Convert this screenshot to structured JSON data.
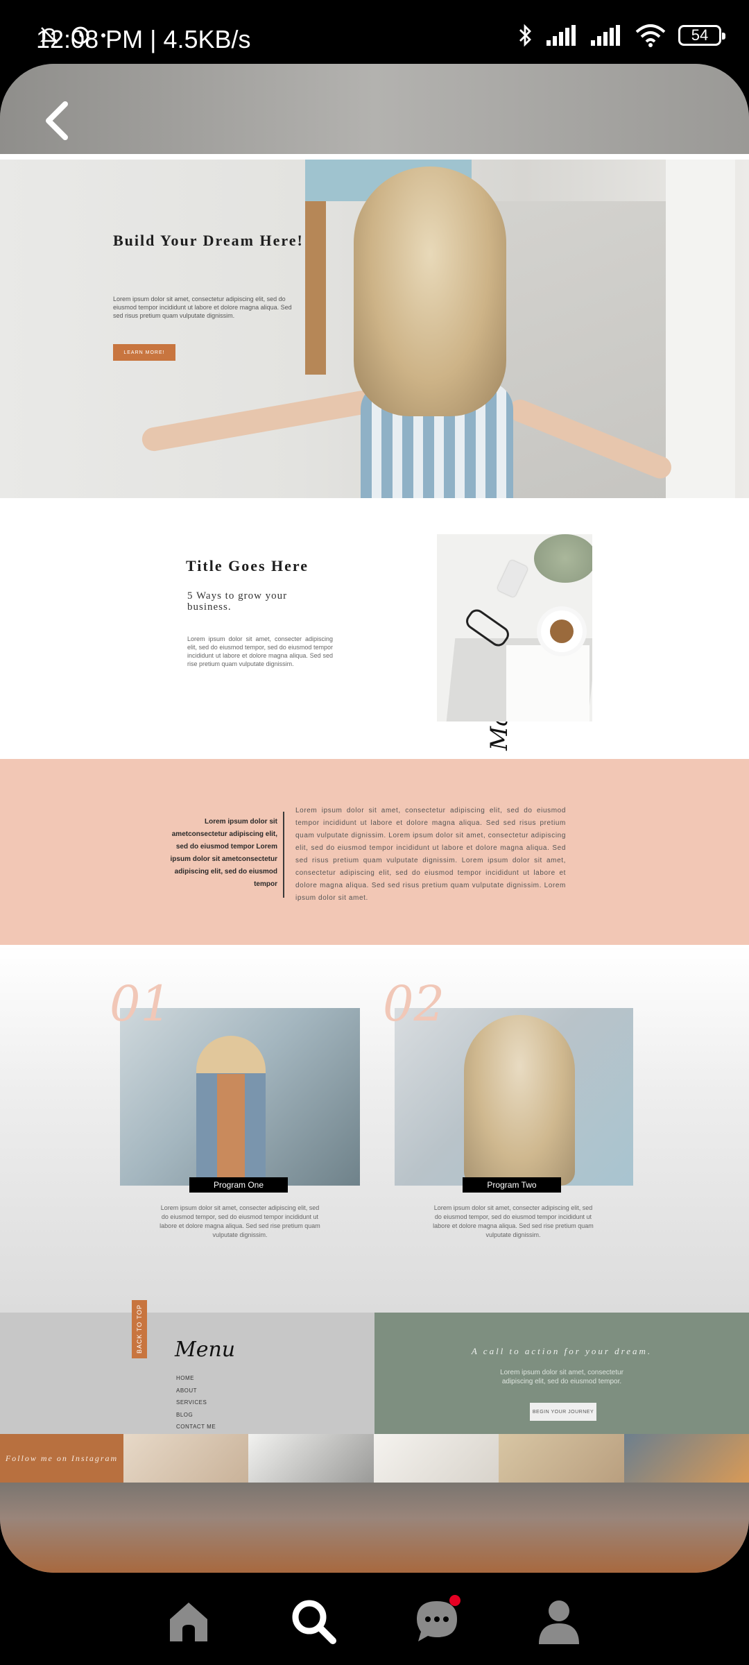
{
  "status_bar": {
    "time": "12:08 PM | 4.5KB/s",
    "battery": "54",
    "icons": [
      "mute-icon",
      "alarm-icon",
      "bluetooth-icon",
      "signal-icon",
      "signal-icon",
      "wifi-icon",
      "battery-icon"
    ]
  },
  "hero": {
    "title": "Build Your Dream Here!",
    "text": "Lorem ipsum dolor sit amet, consectetur adipiscing elit, sed do eiusmod tempor incididunt ut labore et dolore magna aliqua. Sed sed risus pretium quam vulputate dignissim.",
    "button": "LEARN MORE!"
  },
  "section2": {
    "title": "Title Goes Here",
    "subtitle": "5 Ways to grow your business.",
    "text": "Lorem ipsum dolor sit amet, consecter adipiscing elit, sed do eiusmod tempor, sed do eiusmod tempor incididunt ut labore et dolore magna aliqua. Sed sed rise pretium quam vulputate dignissim.",
    "script_label": "Free Masterclass"
  },
  "pink_band": {
    "left": "Lorem ipsum dolor sit ametconsectetur adipiscing elit, sed do eiusmod tempor Lorem ipsum dolor sit ametconsectetur adipiscing elit, sed do eiusmod tempor",
    "right": "Lorem ipsum dolor sit amet, consectetur adipiscing elit, sed do eiusmod tempor incididunt ut labore et dolore magna aliqua. Sed sed risus pretium quam vulputate dignissim. Lorem ipsum dolor sit amet, consectetur adipiscing elit, sed do eiusmod tempor incididunt ut labore et dolore magna aliqua. Sed sed risus pretium quam vulputate dignissim. Lorem ipsum dolor sit amet, consectetur adipiscing elit, sed do eiusmod tempor incididunt ut labore et dolore magna aliqua. Sed sed risus pretium quam vulputate dignissim. Lorem ipsum dolor sit amet."
  },
  "programs": [
    {
      "number": "01",
      "label": "Program One",
      "text": "Lorem ipsum dolor sit amet, consecter adipiscing elit, sed do eiusmod tempor, sed do eiusmod tempor incididunt ut labore et dolore magna aliqua. Sed sed rise pretium quam vulputate dignissim."
    },
    {
      "number": "02",
      "label": "Program Two",
      "text": "Lorem ipsum dolor sit amet, consecter adipiscing elit, sed do eiusmod tempor, sed do eiusmod tempor incididunt ut labore et dolore magna aliqua. Sed sed rise pretium quam vulputate dignissim."
    }
  ],
  "footer": {
    "back_to_top": "BACK TO TOP",
    "menu_title": "Menu",
    "menu_items": [
      "HOME",
      "ABOUT",
      "SERVICES",
      "BLOG",
      "CONTACT ME"
    ],
    "cta_title": "A call to action for your dream.",
    "cta_text": "Lorem ipsum dolor sit amet, consectetur adipiscing elit, sed do eiusmod tempor.",
    "cta_button": "BEGIN YOUR JOURNEY"
  },
  "instagram": {
    "follow": "Follow me on Instagram"
  },
  "colors": {
    "accent_orange": "#c8753f",
    "pink": "#f2c7b5",
    "sage": "#7e8f80",
    "notification": "#e60023"
  },
  "bottom_nav": [
    "home-icon",
    "search-icon",
    "messages-icon",
    "profile-icon"
  ]
}
